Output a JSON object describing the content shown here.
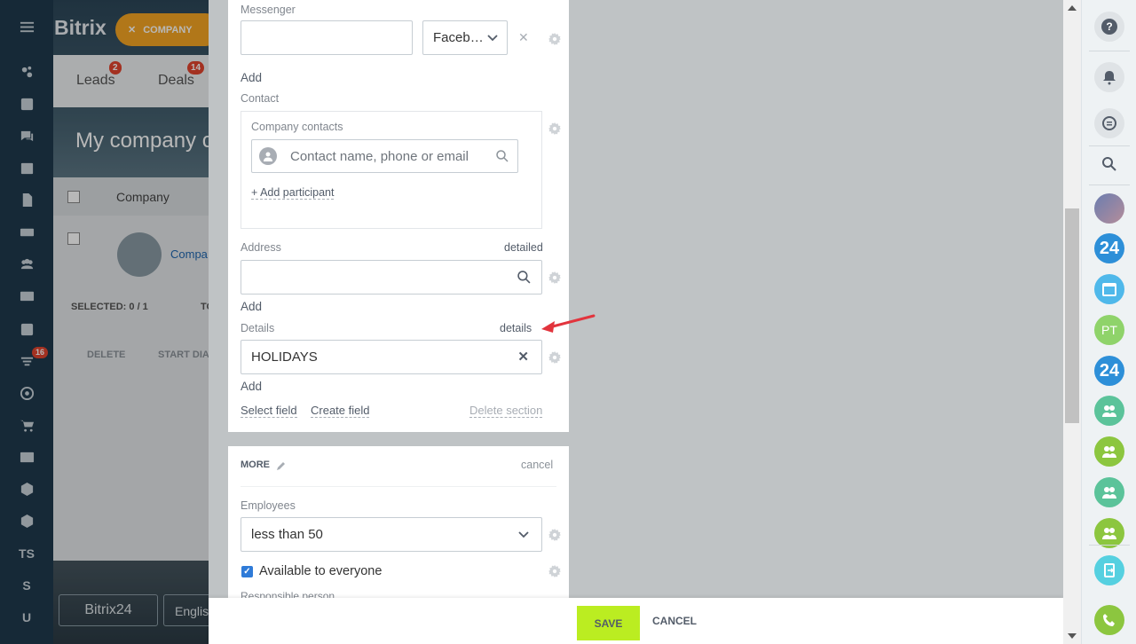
{
  "left_nav": {
    "menu_icon": "hamburger-icon",
    "badge": "16",
    "text_items": [
      "TS",
      "S",
      "U"
    ]
  },
  "background_app": {
    "logo": "Bitrix",
    "company_chip": "COMPANY",
    "tabs": [
      {
        "label": "Leads",
        "badge": "2"
      },
      {
        "label": "Deals",
        "badge": "14"
      }
    ],
    "page_title": "My company c",
    "grid_header": "Company",
    "row_name": "Compa",
    "selected": "SELECTED: 0 / 1",
    "total": "TO",
    "delete_label": "DELETE",
    "start_dialog": "START DIA",
    "bottom_logo": "Bitrix24",
    "language": "Englis"
  },
  "form": {
    "messenger_label": "Messenger",
    "messenger_value": "",
    "messenger_type": "Faceb…",
    "add_label": "Add",
    "contact_label": "Contact",
    "company_contacts_label": "Company contacts",
    "contact_placeholder": "Contact name, phone or email",
    "add_participant": "+ Add participant",
    "address_label": "Address",
    "address_detailed": "detailed",
    "address_value": "",
    "details_label": "Details",
    "details_link": "details",
    "details_value": "HOLIDAYS",
    "select_field": "Select field",
    "create_field": "Create field",
    "delete_section": "Delete section"
  },
  "more_section": {
    "title": "MORE",
    "cancel": "cancel",
    "employees_label": "Employees",
    "employees_value": "less than 50",
    "available_label": "Available to everyone",
    "available_checked": true,
    "responsible_label": "Responsible person"
  },
  "footer": {
    "save": "SAVE",
    "cancel": "CANCEL"
  },
  "right_bar": {
    "pt_initials": "PT",
    "b24_label": "24"
  },
  "colors": {
    "accent_green": "#bbed21",
    "annotation_red": "#e2343d",
    "chip_orange": "#f5a623"
  }
}
